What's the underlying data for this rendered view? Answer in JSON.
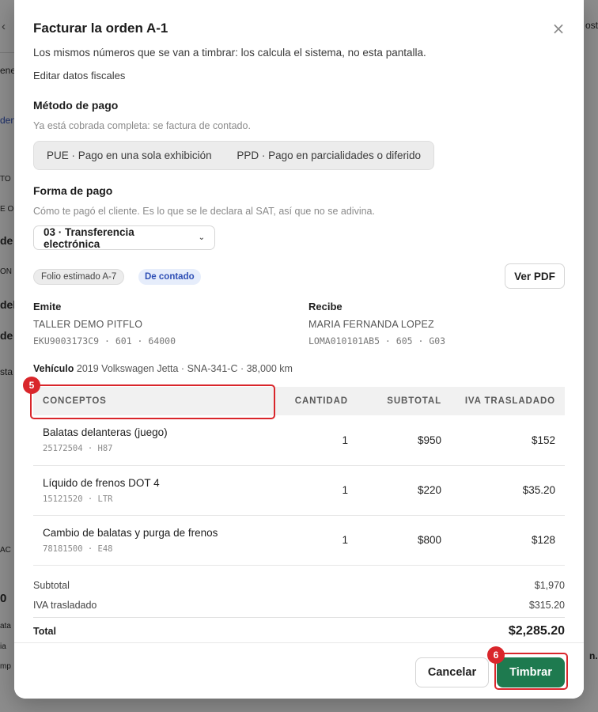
{
  "modal": {
    "title": "Facturar la orden A-1",
    "subtitle": "Los mismos números que se van a timbrar: los calcula el sistema, no esta pantalla.",
    "close_label": "×",
    "edit_fiscal_link": "Editar datos fiscales"
  },
  "metodo_pago": {
    "title": "Método de pago",
    "hint": "Ya está cobrada completa: se factura de contado.",
    "options": [
      "PUE · Pago en una sola exhibición",
      "PPD · Pago en parcialidades o diferido"
    ]
  },
  "forma_pago": {
    "title": "Forma de pago",
    "hint": "Cómo te pagó el cliente. Es lo que se le declara al SAT, así que no se adivina.",
    "selected": "03 · Transferencia electrónica"
  },
  "badges": {
    "folio": "Folio estimado A-7",
    "contado": "De contado"
  },
  "ver_pdf_label": "Ver PDF",
  "emite": {
    "label": "Emite",
    "name": "TALLER DEMO PITFLO",
    "rfc_line": "EKU9003173C9 · 601 · 64000"
  },
  "recibe": {
    "label": "Recibe",
    "name": "MARIA FERNANDA LOPEZ",
    "rfc_line": "LOMA010101AB5 · 605 · G03"
  },
  "vehicle": {
    "label": "Vehículo",
    "text": "2019 Volkswagen Jetta · SNA-341-C · 38,000 km"
  },
  "table": {
    "headers": [
      "CONCEPTOS",
      "CANTIDAD",
      "SUBTOTAL",
      "IVA TRASLADADO"
    ],
    "rows": [
      {
        "desc": "Balatas delanteras (juego)",
        "code": "25172504 · H87",
        "qty": "1",
        "subtotal": "$950",
        "iva": "$152"
      },
      {
        "desc": "Líquido de frenos DOT 4",
        "code": "15121520 · LTR",
        "qty": "1",
        "subtotal": "$220",
        "iva": "$35.20"
      },
      {
        "desc": "Cambio de balatas y purga de frenos",
        "code": "78181500 · E48",
        "qty": "1",
        "subtotal": "$800",
        "iva": "$128"
      }
    ]
  },
  "totals": {
    "subtotal_label": "Subtotal",
    "subtotal_value": "$1,970",
    "iva_label": "IVA trasladado",
    "iva_value": "$315.20",
    "total_label": "Total",
    "total_value": "$2,285.20"
  },
  "footer": {
    "cancel_label": "Cancelar",
    "timbrar_label": "Timbrar"
  },
  "annotations": {
    "step_5": "5",
    "step_6": "6"
  },
  "background": {
    "fragments": [
      "ost",
      "ene",
      "den",
      "TO",
      "E O",
      "de",
      "ON",
      "dela",
      "de",
      "sta",
      "AC",
      "0",
      "ata",
      "ia",
      "r",
      "mp",
      "n."
    ]
  },
  "colors": {
    "primary_button": "#1e7a4f",
    "annotation_red": "#d9262b",
    "badge_blue_bg": "#e6edfb",
    "badge_blue_text": "#2e4fb5"
  }
}
